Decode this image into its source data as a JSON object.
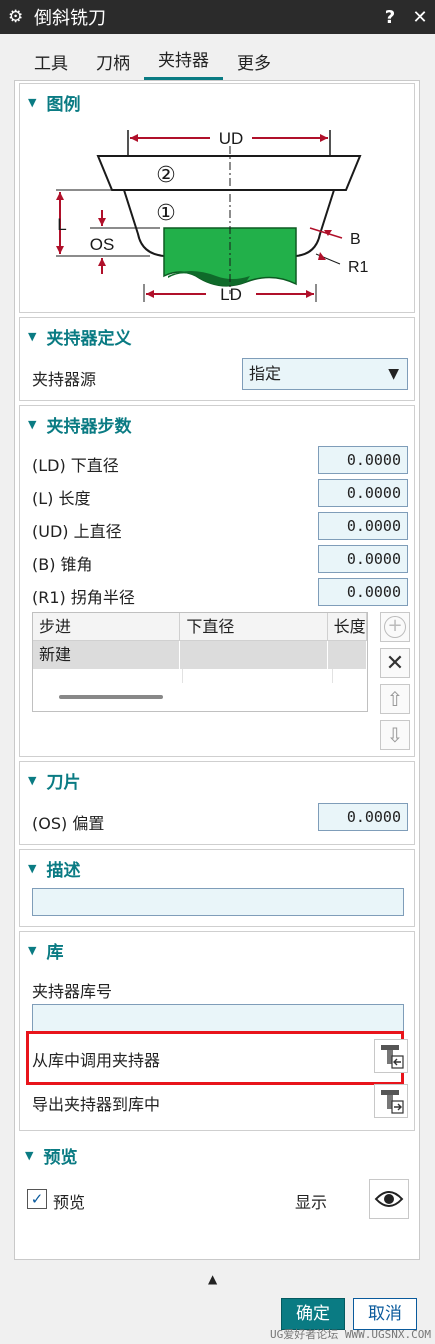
{
  "window": {
    "title": "倒斜铣刀",
    "help": "?",
    "close": "✕"
  },
  "tabs": [
    {
      "label": "工具"
    },
    {
      "label": "刀柄"
    },
    {
      "label": "夹持器"
    },
    {
      "label": "更多"
    }
  ],
  "legend": {
    "header": "图例",
    "labels": {
      "ud": "UD",
      "ld": "LD",
      "l": "L",
      "os": "OS",
      "b": "B",
      "r1": "R1",
      "n1": "①",
      "n2": "②"
    },
    "colors": {
      "dim": "#b0102a",
      "tool": "#22b04a",
      "line": "#1a1a1a"
    }
  },
  "holder_def": {
    "header": "夹持器定义",
    "source_label": "夹持器源",
    "source_value": "指定"
  },
  "holder_steps": {
    "header": "夹持器步数",
    "fields": [
      {
        "label": "(LD) 下直径",
        "value": "0.0000"
      },
      {
        "label": "(L) 长度",
        "value": "0.0000"
      },
      {
        "label": "(UD) 上直径",
        "value": "0.0000"
      },
      {
        "label": "(B) 锥角",
        "value": "0.0000"
      },
      {
        "label": "(R1) 拐角半径",
        "value": "0.0000"
      }
    ],
    "table": {
      "columns": [
        "步进",
        "下直径",
        "长度"
      ],
      "rows": [
        [
          "新建",
          "",
          ""
        ]
      ]
    }
  },
  "insert": {
    "header": "刀片",
    "offset_label": "(OS) 偏置",
    "offset_value": "0.0000"
  },
  "description": {
    "header": "描述",
    "value": ""
  },
  "library": {
    "header": "库",
    "number_label": "夹持器库号",
    "number_value": "",
    "retrieve_label": "从库中调用夹持器",
    "export_label": "导出夹持器到库中"
  },
  "preview": {
    "header": "预览",
    "checkbox_label": "预览",
    "checked": true,
    "show_label": "显示"
  },
  "footer": {
    "ok": "确定",
    "cancel": "取消",
    "watermark": "UG爱好者论坛 WWW.UGSNX.COM"
  },
  "colors": {
    "accent": "#0a7b83",
    "highlight": "#e8141b",
    "field_bg": "#e9f5f9"
  }
}
